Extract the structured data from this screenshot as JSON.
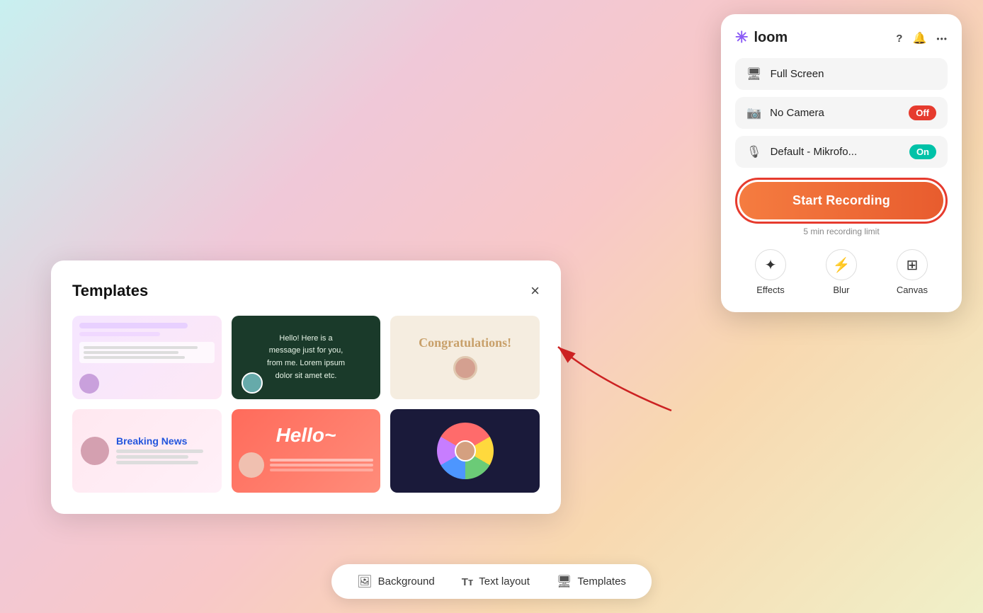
{
  "app": {
    "name": "loom"
  },
  "panel": {
    "title": "loom",
    "fullscreen_label": "Full Screen",
    "camera_label": "No Camera",
    "camera_toggle": "Off",
    "mic_label": "Default - Mikrofo...",
    "mic_toggle": "On",
    "start_recording_label": "Start Recording",
    "recording_limit": "5 min recording limit",
    "effects_label": "Effects",
    "blur_label": "Blur",
    "canvas_label": "Canvas"
  },
  "templates_modal": {
    "title": "Templates",
    "close_label": "×",
    "templates": [
      {
        "id": "tpl1",
        "type": "presentation"
      },
      {
        "id": "tpl2",
        "type": "message",
        "text": "Hello! Here is a\nmessage just for you,\nfrom me. Lorem ipsum\ndolor sit amet etc."
      },
      {
        "id": "tpl3",
        "type": "congratulations",
        "text": "Congratulations!"
      },
      {
        "id": "tpl4",
        "type": "breaking-news",
        "text": "Breaking News"
      },
      {
        "id": "tpl5",
        "type": "hello",
        "text": "Hello~"
      },
      {
        "id": "tpl6",
        "type": "colorful"
      }
    ]
  },
  "toolbar": {
    "background_label": "Background",
    "text_layout_label": "Text layout",
    "templates_label": "Templates"
  }
}
